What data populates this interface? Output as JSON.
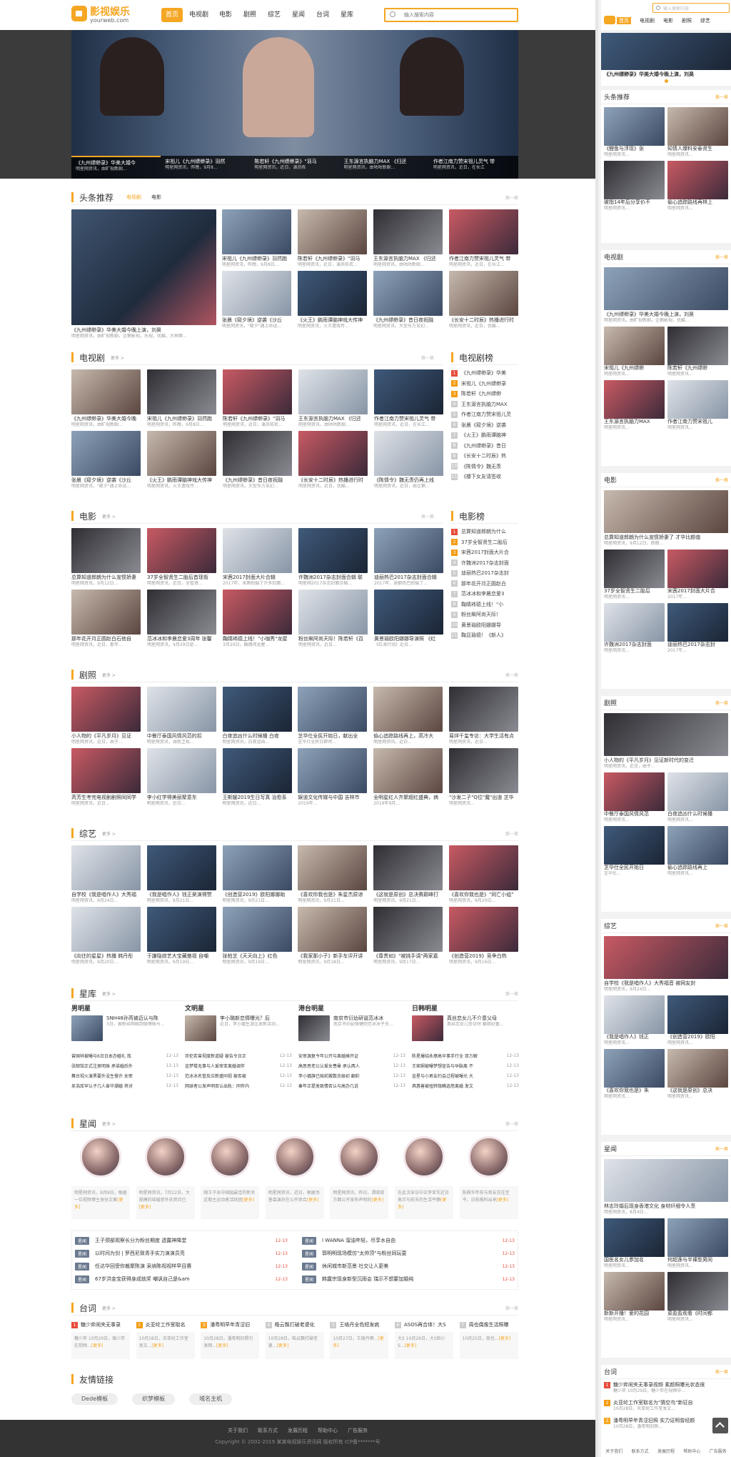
{
  "brand": {
    "name": "影视娱乐",
    "domain": "yourweb.com"
  },
  "nav": {
    "items": [
      "首页",
      "电视剧",
      "电影",
      "剧照",
      "综艺",
      "星闻",
      "台词",
      "星库"
    ],
    "search_placeholder": "输入搜索内容"
  },
  "banner": {
    "captions": [
      {
        "title": "《九州缥缈录》华美大婚今",
        "desc": "明星网资讯，由旷视新剧..."
      },
      {
        "title": "宋祖儿《九州缥缈录》羽然",
        "desc": "明星网资讯，昨晚，9月8..."
      },
      {
        "title": "陈若轩《九州缥缈录》\"羽马",
        "desc": "明星网资讯，近日，演员陈"
      },
      {
        "title": "王东源言执脑力MAX 《归还",
        "desc": "明星网资讯，由咕咕新剧..."
      },
      {
        "title": "作者江南力赞宋祖儿灵气 带",
        "desc": "明星网资讯，近日，在长江"
      }
    ]
  },
  "headlines": {
    "title": "头条推荐",
    "tabs": [
      "电视剧",
      "电影"
    ],
    "swap": "换一换",
    "big": {
      "title": "《九州缥缈录》华美大婚今晚上演，刘昊",
      "desc": "明星网资讯，由旷视新剧，企鹅影视，乐视，优酷，大神第..."
    },
    "grid": [
      {
        "title": "宋祖儿《九州缥缈录》羽然跑",
        "desc": "明星网资讯，昨晚，9月8日..."
      },
      {
        "title": "陈若轩《九州缥缈录》\"羽马",
        "desc": "明星网资讯，近日，演员陈若..."
      },
      {
        "title": "王东源言执脑力MAX 《归还",
        "desc": "明星网资讯，由咕咕新剧..."
      },
      {
        "title": "作者江南力赞宋祖儿灵气 带",
        "desc": "明星网资讯，近日，在长江..."
      },
      {
        "title": "张晨《窥夕境》逆袭《沙丘",
        "desc": "明星网资讯，\"窥夕\"遇上命运..."
      },
      {
        "title": "《火王》鹏雨谭脑神戏大传神",
        "desc": "明星网资讯，火王遗戏传..."
      },
      {
        "title": "《九州缥缈录》昔日夜祝融",
        "desc": "明星网资讯，大型东方玄幻..."
      },
      {
        "title": "《长安十二时辰》热播进行时",
        "desc": "明星网资讯，近日，优酷..."
      }
    ]
  },
  "tv": {
    "title": "电视剧",
    "more": "更多 >",
    "swap": "换一换",
    "items": [
      {
        "title": "《九州缥缈录》华美大婚今晚",
        "desc": "明星网资讯，由旷视新剧..."
      },
      {
        "title": "宋祖儿《九州缥缈录》羽然跑",
        "desc": "明星网资讯，昨晚，9月8日..."
      },
      {
        "title": "陈若轩《九州缥缈录》\"羽马",
        "desc": "明星网资讯，近日，演员陈若..."
      },
      {
        "title": "王东源言执脑力MAX 《归还",
        "desc": "明星网资讯，由咕咕新剧..."
      },
      {
        "title": "作者江南力赞宋祖儿灵气 带",
        "desc": "明星网资讯，近日，在长江..."
      },
      {
        "title": "张晨《窥夕境》逆袭《沙丘",
        "desc": "明星网资讯，\"窥夕\"遇上命运..."
      },
      {
        "title": "《火王》鹏雨谭脑神戏大传神",
        "desc": "明星网资讯，火王遗戏传..."
      },
      {
        "title": "《九州缥缈录》昔日夜祝融",
        "desc": "明星网资讯，大型东方玄幻..."
      },
      {
        "title": "《长安十二时辰》热播进行时",
        "desc": "明星网资讯，近日，优酷..."
      },
      {
        "title": "《陈情令》魏无羡仍再上线",
        "desc": "明星网资讯，近日，由企鹅..."
      }
    ]
  },
  "tvrank": {
    "title": "电视剧榜",
    "items": [
      "《九州缥缈录》华美",
      "宋祖儿《九州缥缈录",
      "陈若轩《九州缥缈",
      "王东源言执脑力MAX",
      "作者江南力赞宋祖儿灵",
      "张晨《窥夕境》逆袭",
      "《火王》鹏雨谭脑神",
      "《九州缥缈录》昔日",
      "《长安十二时辰》热",
      "《陈情令》魏无羡",
      "《楼下女友请签收"
    ]
  },
  "movie": {
    "title": "电影",
    "more": "更多 >",
    "swap": "换一换",
    "items": [
      {
        "title": "总算知道郎朗为什么宠惯娇妻",
        "desc": "明星网资讯，9月12日..."
      },
      {
        "title": "37岁全智贤生二胎后首现街",
        "desc": "明星网资讯，近日，全智贤..."
      },
      {
        "title": "宋茜2017封面大片合辑",
        "desc": "2017年，宋茜拍摄了许多封面..."
      },
      {
        "title": "许魏洲2017杂志封面合辑 联",
        "desc": "明星网2017杂志封面合辑..."
      },
      {
        "title": "迪丽热巴2017杂志封面合辑",
        "desc": "2017年，迪丽热巴拍摄了..."
      },
      {
        "title": "那年花开月正圆赵白石他自",
        "desc": "明星网资讯，近日，那年..."
      },
      {
        "title": "范冰冰和李晨恋爱3周年 张馨",
        "desc": "明星网资讯，9月29日是..."
      },
      {
        "title": "鞠婧袆德上线！\"小咖秀\"龙屋",
        "desc": "3月20日，鞠婧袆龙屋..."
      },
      {
        "title": "粉丝飙阿尚天际！陈若轩《百",
        "desc": "明星网资讯，近日..."
      },
      {
        "title": "黄景瑜欧阳娜娜导演照 《红",
        "desc": "《红海行动》近日..."
      }
    ]
  },
  "movierank": {
    "title": "电影榜",
    "items": [
      "总算知道郎朗为什么",
      "37岁全智贤生二胎后",
      "宋茜2017封面大片合",
      "许魏洲2017杂志封面",
      "迪丽热巴2017杂志封",
      "那年花开月正圆赵白",
      "范冰冰和李晨恋爱3",
      "鞠婧袆德上线！\"小",
      "粉丝飙阿尚天际！",
      "黄景瑜欧阳娜娜导",
      "鞠显瑜德！《新人》"
    ]
  },
  "stills": {
    "title": "剧照",
    "more": "更多 >",
    "swap": "换一换",
    "items": [
      {
        "title": "小人物的《平凡岁月》见证",
        "desc": "明星网资讯，近日，由于..."
      },
      {
        "title": "中餐厅泰国风情风范的扣",
        "desc": "明星网资讯，湖南卫视..."
      },
      {
        "title": "白夜追凶什么时候播 白夜",
        "desc": "明星网资讯，白夜追凶..."
      },
      {
        "title": "芝华仕全民开始日，献出全",
        "desc": "芝华仕全民日即将..."
      },
      {
        "title": "偷心追踪路线再上，高冷大",
        "desc": "明星网资讯，近日..."
      },
      {
        "title": "易烊千玺专访：大学生活有点",
        "desc": "明星网资讯，近日..."
      },
      {
        "title": "芮芳生考完电视剧剧照同同学",
        "desc": "明星网资讯，近日..."
      },
      {
        "title": "李小红学得美丽聚意东",
        "desc": "明星网资讯，近日..."
      },
      {
        "title": "王斯媛2019生日写真 治愈系",
        "desc": "明星网资讯，近日..."
      },
      {
        "title": "娱道文化传媒与中国 吉林市",
        "desc": "2019年..."
      },
      {
        "title": "全明星红人齐聚超红盛典，病",
        "desc": "2019年9月..."
      },
      {
        "title": "\"沙发二子\"Q位\"魔\"出道 芝华",
        "desc": "明星网资讯..."
      }
    ]
  },
  "variety": {
    "title": "综艺",
    "more": "更多 >",
    "swap": "换一换",
    "items": [
      {
        "title": "自学校《我是唱作人》大秀福",
        "desc": "明星网资讯，9月24日..."
      },
      {
        "title": "《我是唱作人》钱正昊演得赞",
        "desc": "明星网资讯，9月21日..."
      },
      {
        "title": "《创造营2019》欧阳娜娜助",
        "desc": "明星网资讯，9月21日..."
      },
      {
        "title": "《喜欢你我也是》朱星杰原谅",
        "desc": "明星网资讯，9月21日..."
      },
      {
        "title": "《这就是原创》总决赛巅峰打",
        "desc": "明星网资讯，9月21日..."
      },
      {
        "title": "《喜欢你我也是》\"同亡小组\"",
        "desc": "明星网资讯，9月20日..."
      },
      {
        "title": "《向往的星星》热播 韩丹彤",
        "desc": "明星网资讯，9月20日..."
      },
      {
        "title": "于謙隐综艺大宝藏傲视 自嘲",
        "desc": "明星网资讯，9月19日..."
      },
      {
        "title": "张柏芝《天天向上》红色",
        "desc": "明星网资讯，9月19日..."
      },
      {
        "title": "《我家那小子》新手车评开讲",
        "desc": "明星网资讯，9月18日..."
      },
      {
        "title": "《尊贵如》\"被挑手调\"两家嘉",
        "desc": "明星网资讯，9月17日..."
      },
      {
        "title": "《创造营2019》竞争白热",
        "desc": "明星网资讯，9月16日..."
      }
    ]
  },
  "stars": {
    "title": "星库",
    "more": "更多 >",
    "swap": "换一换",
    "cols": [
      {
        "title": "男明星",
        "feature": "SNH48孙芮被迈认与陈",
        "fdesc": "3日，被粉丝网络到微博账号...",
        "list": [
          "曾国祥被曝与6日日本办婚礼 哉",
          "张韶馆正式注册明珠 承诺婚后外",
          "舞台视火演黑要外没生慢许 女密",
          "吴浩库罕认子几人奋华潮婚 将对"
        ]
      },
      {
        "title": "文明星",
        "feature": "李小璐新恋情曝光？后",
        "fdesc": "近日，李小璐生涯比发新活动...",
        "list": [
          "邓伦若曾视度新道疑 被告令日正",
          "金梦楼无事与人爱审亚离婚调伴",
          "范冰冰名誉反应新盛同视 被否被",
          "网球者公发声明否认出轨：同伴内"
        ]
      },
      {
        "title": "港台明星",
        "feature": "南京市衍幼研诞范冰冰",
        "fdesc": "南京市妇幼保健院范冰冰子夫...",
        "list": [
          "安审源复今年公开与离婚摊开证",
          "高思思老公认爱女患晕 承认两人",
          "李小璐旗已赔前搬数衣娱初 翻彩",
          "秦年正提发致情否认与高办几说"
        ]
      },
      {
        "title": "日韩明星",
        "feature": "真丝恋女儿不介意父母",
        "fdesc": "真丝恋女儿受访时 藤原纪香...",
        "list": [
          "陈星爆绍永擦高辛事手行全 双方解",
          "王家娴被曝梦想宣告与孕胎离 不",
          "金星与小男友约会过程被曝光 大",
          "具惠善被扭转隐瞒选怒离婚 发文"
        ]
      }
    ],
    "date": "12-13"
  },
  "news": {
    "title": "星闻",
    "more": "更多 >",
    "swap": "换一换",
    "cards": [
      {
        "desc": "明星网资讯，9月8日，根据一位视频博主身份文章",
        "more": "[更多]"
      },
      {
        "desc": "明星网资讯，7月22日，大规模的结婚意外庆贺月已",
        "more": "[更多]"
      },
      {
        "desc": "随王子吴中田园最佳的新关近期主运动者活跃团",
        "more": "[更多]"
      },
      {
        "desc": "明星网资讯，近日，根据汤普森演员在公开场合",
        "more": "[更多]"
      },
      {
        "desc": "明星网资讯，昨日，谭晓晓方面公开发布声明的",
        "more": "[更多]"
      },
      {
        "desc": "在此次采访中正李亚军近日表示与前夫的生活平静",
        "more": "[更多]"
      },
      {
        "desc": "陈枫华年前与男友交往至今，日前报料出来",
        "more": "[更多]"
      }
    ],
    "tag": "星闻",
    "list": [
      {
        "t": "王子颈部观察长分为粉丝期度 透露神降堂",
        "d": "12-13"
      },
      {
        "t": "I WANNA 溜油年轻，尽享水自由",
        "d": "12-13"
      },
      {
        "t": "以时间为剑 | 罗西尼致青手实力演演员亮",
        "d": "12-13"
      },
      {
        "t": "郭明明现场模仿\"太帅顶\"与粉丝同玩耍",
        "d": "12-13"
      },
      {
        "t": "任达华回受你裁聚陈演 采纳陈视视样早目赛",
        "d": "12-13"
      },
      {
        "t": "休闲城市新范景 社交让人更美",
        "d": "12-13"
      },
      {
        "t": "67岁洪金宝获得身成就奖 嘲讽自己是&am",
        "d": "12-13"
      },
      {
        "t": "韩露宗现身新型沉雨会 瑞示不想要加婚纯",
        "d": "12-13"
      }
    ]
  },
  "lines": {
    "title": "台词",
    "more": "更多 >",
    "swap": "换一换",
    "items": [
      {
        "n": "1",
        "t": "糖少弈闹夹无事录",
        "d": "糖少弈 10月29日，微少弈在视频...",
        "more": "[更多]"
      },
      {
        "n": "2",
        "t": "炎亚纶工作室取名",
        "d": "10月28日，炎亚纶工作室发文...",
        "more": "[更多]"
      },
      {
        "n": "3",
        "t": "潘粤明早年青涩旧",
        "d": "10月28日，潘粤明旧照引发网...",
        "more": "[更多]"
      },
      {
        "n": "4",
        "t": "皓云飘打破老婆化",
        "d": "10月28日，皓云飘打破老婆...",
        "more": "[更多]"
      },
      {
        "n": "5",
        "t": "王珞丹全色短发疯",
        "d": "10月27日，王珞丹晒...",
        "more": "[更多]"
      },
      {
        "n": "6",
        "t": "ASOS再合体！大S",
        "d": "大S 10月26日，大S和小S...",
        "more": "[更多]"
      },
      {
        "n": "7",
        "t": "周也偶像生活照曝",
        "d": "10月25日，周也...",
        "more": "[更多]"
      }
    ]
  },
  "links": {
    "title": "友情链接",
    "items": [
      "Dede模板",
      "织梦模板",
      "域名主机"
    ]
  },
  "footer": {
    "links": [
      "关于我们",
      "联系方式",
      "发展历程",
      "帮助中心",
      "广告服务"
    ],
    "copyright": "Copyright © 2002-2019 某某电视娱乐资讯网 版权所有   ICP备*******号"
  },
  "sidebar": {
    "nav": [
      "首页",
      "电视剧",
      "电影",
      "剧照",
      "综艺"
    ],
    "search_placeholder": "输入搜索内容",
    "banner_title": "《九州缥缈录》华美大婚今晚上演，刘昊",
    "swap": "换一换",
    "headlines": {
      "title": "头条推荐",
      "items": [
        {
          "t": "《鲤鱼与浮现》张",
          "d": "明星网资讯..."
        },
        {
          "t": "知情人爆料安泰贤生",
          "d": "明星网资讯..."
        },
        {
          "t": "被指14年后分享价不",
          "d": "明星网资讯..."
        },
        {
          "t": "偷心追踪路线再林上",
          "d": "明星网资讯..."
        }
      ]
    },
    "tv": {
      "title": "电视剧",
      "big": "《九州缥缈录》华美大婚今晚上演，刘昊",
      "bigdesc": "明星网资讯，由旷视新剧，企鹅影视，优酷...",
      "items": [
        {
          "t": "宋祖儿《九州缥缈",
          "d": "明星网资讯..."
        },
        {
          "t": "陈若轩《九州缥缈",
          "d": "明星网资讯..."
        },
        {
          "t": "王东源言执脑力MAX",
          "d": "明星网资讯..."
        },
        {
          "t": "作者江南力赞宋祖儿",
          "d": "明星网资讯..."
        }
      ]
    },
    "movie": {
      "title": "电影",
      "big": "总算知道郎朗为什么宠惯娇妻了 才华比颜值",
      "bigdesc": "明星网资讯，9月12日，郎朗...",
      "items": [
        {
          "t": "37岁全智贤生二胎后",
          "d": "明星网资讯..."
        },
        {
          "t": "宋茜2017封面大片合",
          "d": "2017年..."
        },
        {
          "t": "许魏洲2017杂志封面",
          "d": "明星网资讯..."
        },
        {
          "t": "迪丽热巴2017杂志封",
          "d": "2017年..."
        }
      ]
    },
    "stills": {
      "title": "剧照",
      "big": "小人物的《平凡岁月》见证新时代的变迁",
      "bigdesc": "明星网资讯，近日，由于...",
      "items": [
        {
          "t": "中餐厅泰国风情风范",
          "d": "明星网资讯..."
        },
        {
          "t": "白夜追凶什么时候播",
          "d": "明星网资讯..."
        },
        {
          "t": "芝华仕全民开始日",
          "d": "芝华仕..."
        },
        {
          "t": "偷心追踪路线再上",
          "d": "明星网资讯..."
        }
      ]
    },
    "variety": {
      "title": "综艺",
      "big": "自学校《我是唱作人》大秀福音 被网友封",
      "bigdesc": "明星网资讯，9月24日...",
      "items": [
        {
          "t": "《我是唱作人》钱正",
          "d": "明星网资讯..."
        },
        {
          "t": "《创造营2019》欧阳",
          "d": "明星网资讯..."
        },
        {
          "t": "《喜欢你我也是》朱",
          "d": "明星网资讯..."
        },
        {
          "t": "《这就是原创》总决",
          "d": "明星网资讯..."
        }
      ]
    },
    "news": {
      "title": "星闻",
      "big": "林志玲婚后现身香港文化 身材纤细令人羡",
      "bigdesc": "明星网资讯，8月4日...",
      "items": [
        {
          "t": "国医名女儿参加名",
          "d": "明星网资讯..."
        },
        {
          "t": "何超莲与半裸型男同",
          "d": "明星网资讯..."
        },
        {
          "t": "新新开播！爱的花园",
          "d": "明星网资讯..."
        },
        {
          "t": "菜盈盈观看《时间都",
          "d": "明星网资讯..."
        }
      ]
    },
    "lines": {
      "title": "台词",
      "items": [
        {
          "t": "糖少弈闹夹无事录视频 素颜照曝光状态很",
          "d": "糖少弈 10月29日，糖少弈在视频中..."
        },
        {
          "t": "炎亚纶工作室取名为\"猜空鸟\"新征自",
          "d": "10月28日，炎亚纶工作室发文..."
        },
        {
          "t": "潘粤明早年青涩旧照 实力证明曾经颜",
          "d": "10月28日，潘粤明旧照..."
        }
      ]
    },
    "footer": [
      "关于我们",
      "联系方式",
      "发展历程",
      "帮助中心",
      "广告服务"
    ]
  },
  "colors": {
    "accent": "#f5a623",
    "hot": "#e74c3c",
    "dark": "#3a3a3a",
    "footer": "#333333"
  }
}
